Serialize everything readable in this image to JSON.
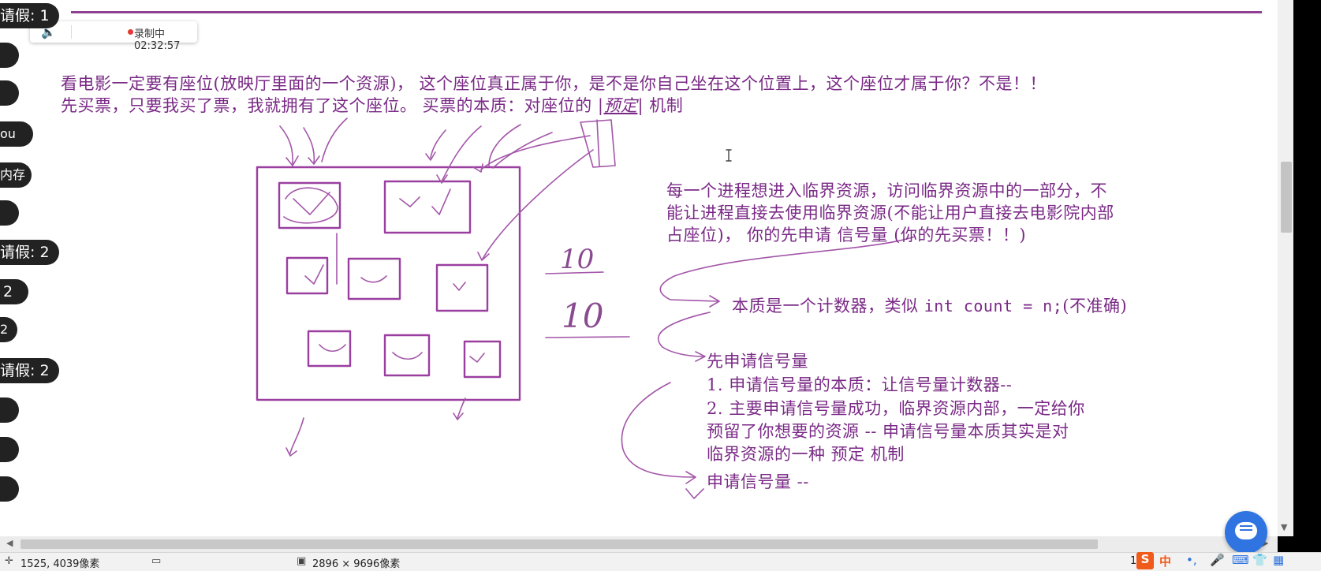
{
  "recording": {
    "text": "录制中02:32:57"
  },
  "chat_sidebar": [
    {
      "text": "请假: 1"
    },
    {
      "text": ""
    },
    {
      "text": ""
    },
    {
      "text": "ou"
    },
    {
      "text": "内存"
    },
    {
      "text": ""
    },
    {
      "text": "请假: 2"
    },
    {
      "text": "2"
    },
    {
      "text": "2"
    },
    {
      "text": "请假: 2"
    },
    {
      "text": ""
    },
    {
      "text": ""
    },
    {
      "text": ""
    }
  ],
  "notes": {
    "line1": "看电影一定要有座位(放映厅里面的一个资源)， 这个座位真正属于你，是不是你自己坐在这个位置上，这个座位才属于你？不是！！",
    "line2_a": "先买票，只要我买了票，我就拥有了这个座位。 买票的本质：对座位的 |",
    "line2_b": "预定",
    "line2_c": "| 机制",
    "block1_l1": "每一个进程想进入临界资源，访问临界资源中的一部分，不",
    "block1_l2": "能让进程直接去使用临界资源(不能让用户直接去电影院内部",
    "block1_l3": "占座位)， 你的先申请 信号量 (你的先买票！！)",
    "essence_a": "本质是一个计数器，类似 ",
    "essence_code": "int count = n;",
    "essence_b": "(不准确)",
    "apply_title": "先申请信号量",
    "apply_1": "1. 申请信号量的本质：让信号量计数器--",
    "apply_2": "2. 主要申请信号量成功，临界资源内部，一定给你",
    "apply_3": "预留了你想要的资源 -- 申请信号量本质其实是对",
    "apply_4": "临界资源的一种 预定 机制",
    "apply_5": "申请信号量 --",
    "hand_top": "10",
    "hand_bottom": "10"
  },
  "statusbar": {
    "cursor_pos": "1525, 4039像素",
    "image_size": "2896 × 9696像素",
    "page_num": "1"
  },
  "tray": {
    "ime_label": "中",
    "punct": "•,",
    "mic_icon": "microphone-icon",
    "kb_icon": "keyboard-icon",
    "shirt_icon": "skin-icon",
    "grid_icon": "toolbox-icon"
  },
  "colors": {
    "ink": "#7a2a86",
    "sketch": "#9a3fa0",
    "accent_blue": "#2f74e0",
    "ime_orange": "#f05a1a"
  }
}
